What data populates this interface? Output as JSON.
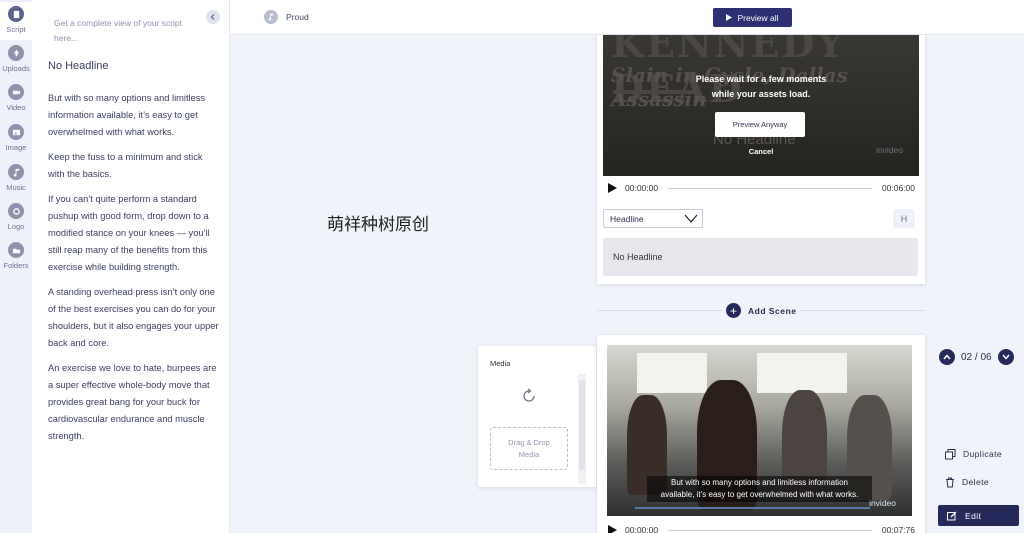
{
  "rail": {
    "items": [
      {
        "label": "Script",
        "icon": "script-icon"
      },
      {
        "label": "Uploads",
        "icon": "upload-icon"
      },
      {
        "label": "Video",
        "icon": "video-icon"
      },
      {
        "label": "Image",
        "icon": "image-icon"
      },
      {
        "label": "Music",
        "icon": "music-icon"
      },
      {
        "label": "Logo",
        "icon": "logo-icon"
      },
      {
        "label": "Folders",
        "icon": "folder-icon"
      }
    ]
  },
  "script": {
    "hint": "Get a complete view of your script here...",
    "title": "No Headline",
    "paragraphs": [
      "But with so many options and limitless information available, it’s easy to get overwhelmed with what works.",
      "Keep the fuss to a minimum and stick with the basics.",
      "If you can’t quite perform a standard pushup with good form, drop down to a modified stance on your knees — you’ll still reap many of the benefits from this exercise while building strength.",
      "A standing overhead press isn’t only one of the best exercises you can do for your shoulders, but it also engages your upper back and core.",
      "An exercise we love to hate, burpees are a super effective whole-body move that provides great bang for your buck for cardiovascular endurance and muscle strength."
    ]
  },
  "topbar": {
    "track_name": "Proud",
    "preview_all": "Preview all"
  },
  "canvas_text": "萌祥种树原创",
  "scene1": {
    "newspaper_head": "KENNEDY DEAD",
    "newspaper_sub": "Slain in Cycle, Dallas Assassin",
    "wait_message_line1": "Please wait for a few moments",
    "wait_message_line2": "while your assets load.",
    "preview_anyway": "Preview Anyway",
    "ghost_headline": "No Headline",
    "cancel": "Cancel",
    "watermark": "invideo",
    "time_current": "00:00:00",
    "time_total": "00:06:00",
    "layout_select": "Headline",
    "h_button": "H",
    "headline_text": "No Headline"
  },
  "add_scene": "Add Scene",
  "media": {
    "title": "Media",
    "drop_line1": "Drag & Drop",
    "drop_line2": "Media"
  },
  "scene2": {
    "caption_line1": "But with so many options and limitless information",
    "caption_line2": "available, it’s easy to get overwhelmed with what works.",
    "watermark": "invideo",
    "time_current": "00:00:00",
    "time_total": "00:07:76"
  },
  "navigator": {
    "counter": "02 / 06"
  },
  "actions": {
    "duplicate": "Duplicate",
    "delete": "Delete",
    "edit": "Edit"
  },
  "colors": {
    "primary": "#252a5a",
    "rail_bg": "#eef1f9",
    "canvas_bg": "#f0f3fa"
  }
}
